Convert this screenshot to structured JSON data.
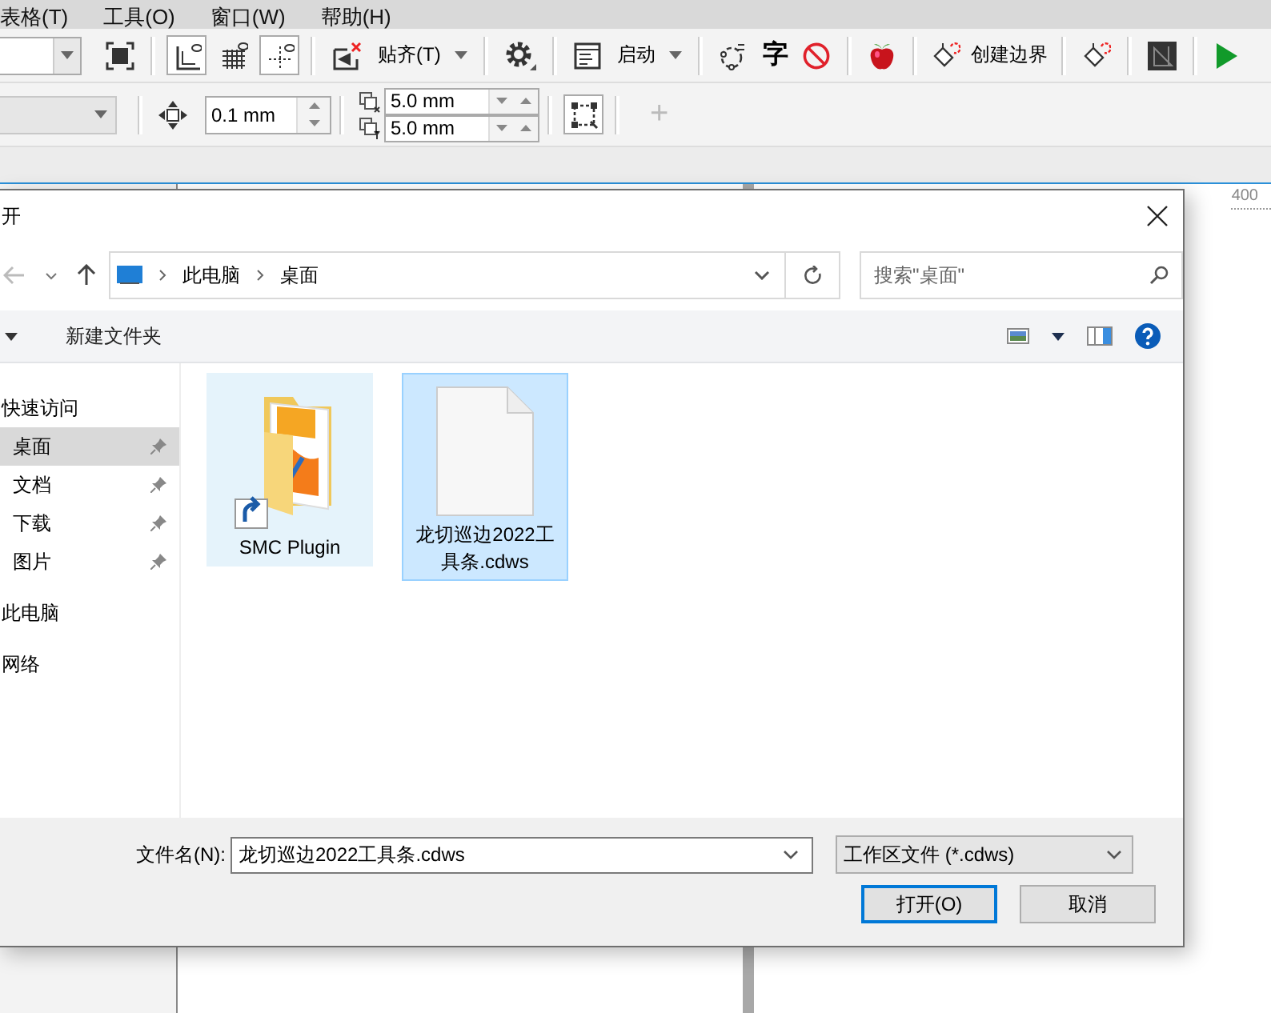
{
  "menu": [
    {
      "label": "表格(T)"
    },
    {
      "label": "工具(O)"
    },
    {
      "label": "窗口(W)"
    },
    {
      "label": "帮助(H)"
    }
  ],
  "toolbar": {
    "view_toggles": [
      {
        "pressed": true
      },
      {
        "pressed": false
      },
      {
        "pressed": true
      }
    ],
    "snap_label": "贴齐(T)",
    "launch_label": "启动",
    "text_glyph": "字",
    "boundary_label": "创建边界"
  },
  "property_bar": {
    "nudge": "0.1 mm",
    "duplicate_x": "5.0 mm",
    "duplicate_y": "5.0 mm",
    "add_button": {
      "label": "+",
      "disabled": true
    }
  },
  "ruler": {
    "label": "400"
  },
  "dialog": {
    "title": "开",
    "path": [
      "此电脑",
      "桌面"
    ],
    "search": {
      "placeholder": "搜索\"桌面\""
    },
    "new_folder": "新建文件夹",
    "nav": [
      {
        "label": "快速访问",
        "selected": false,
        "children": [
          {
            "label": "桌面",
            "selected": true,
            "pinned": true
          },
          {
            "label": "文档",
            "selected": false,
            "pinned": true
          },
          {
            "label": "下载",
            "selected": false,
            "pinned": true
          },
          {
            "label": "图片",
            "selected": false,
            "pinned": true
          }
        ]
      },
      {
        "label": "此电脑",
        "selected": false
      },
      {
        "label": "网络",
        "selected": false
      }
    ],
    "files": [
      {
        "name": "SMC Plugin",
        "kind": "folder-shortcut",
        "selected": false,
        "hovered": true
      },
      {
        "name": "龙切巡边2022工具条.cdws",
        "kind": "document",
        "selected": true,
        "hovered": false
      }
    ],
    "filename_label": "文件名(N):",
    "filename": "龙切巡边2022工具条.cdws",
    "file_type": "工作区文件 (*.cdws)",
    "buttons": [
      {
        "label": "打开(O)",
        "default": true
      },
      {
        "label": "取消",
        "default": false
      }
    ]
  }
}
